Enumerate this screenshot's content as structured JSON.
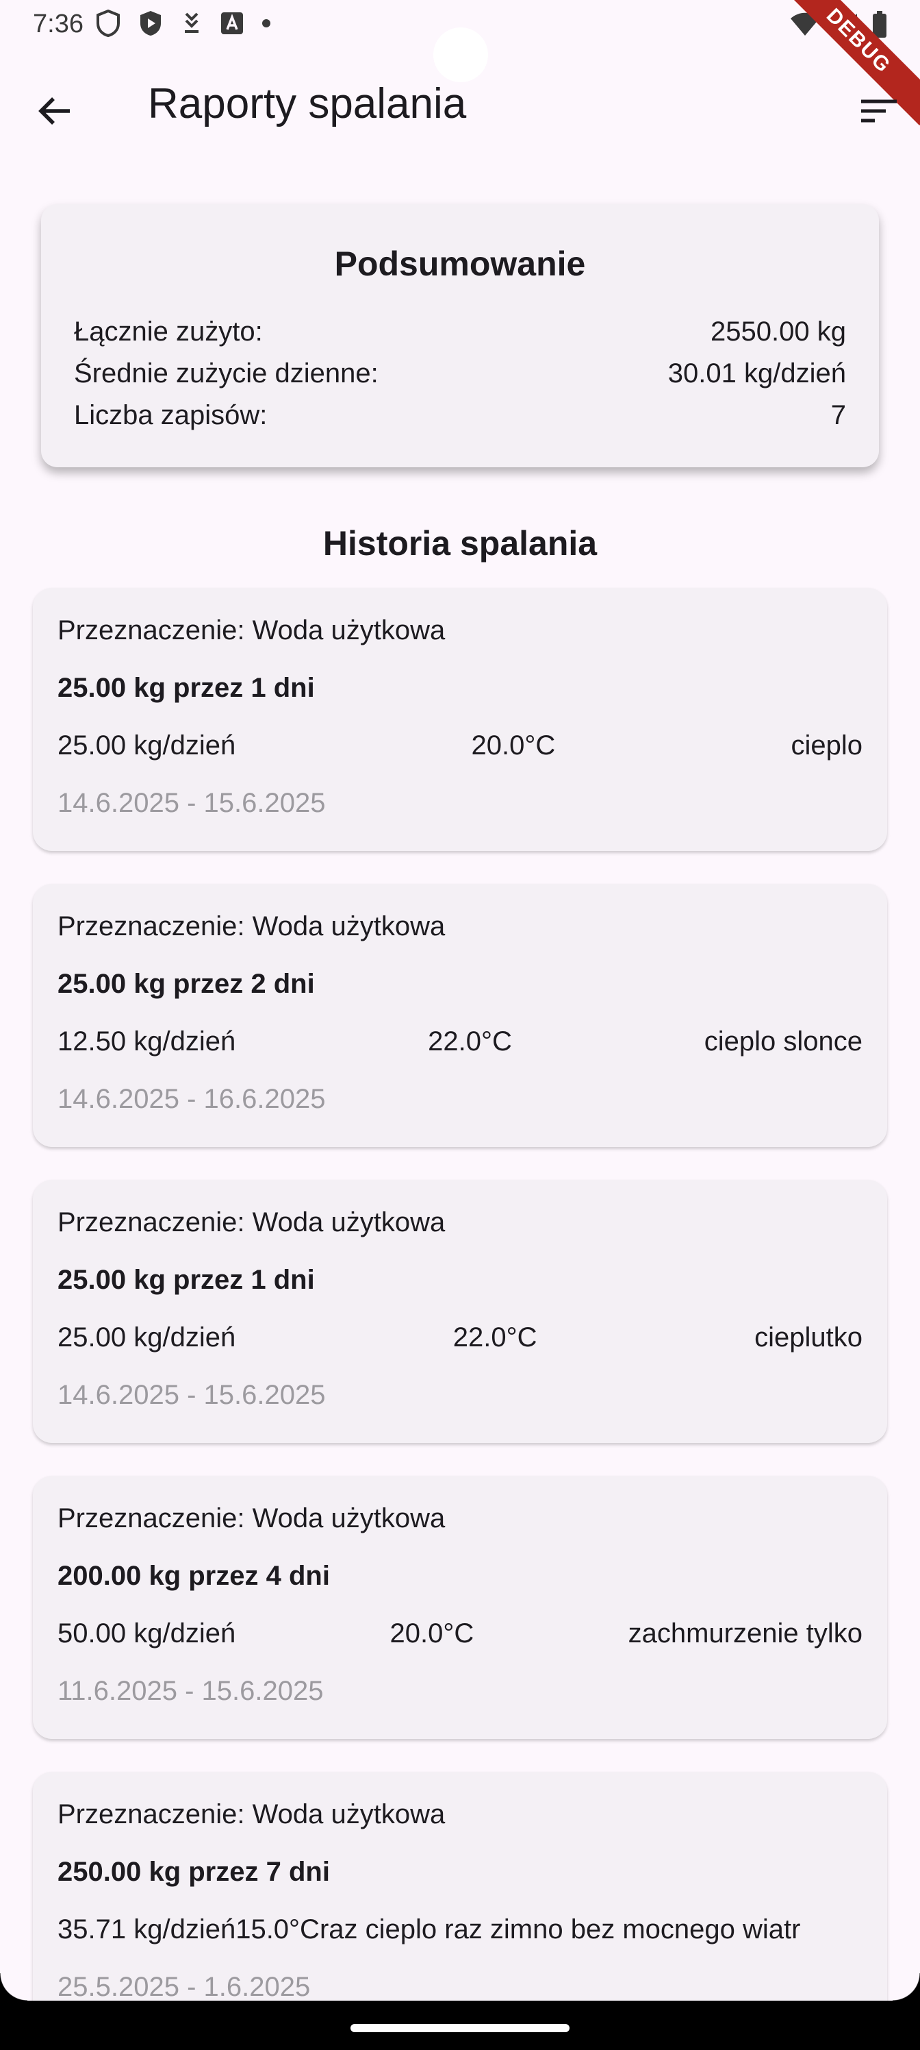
{
  "status_bar": {
    "time": "7:36",
    "debug_label": "DEBUG"
  },
  "app_bar": {
    "title": "Raporty spalania",
    "back_icon": "arrow-back-icon",
    "sort_icon": "sort-icon"
  },
  "summary": {
    "title": "Podsumowanie",
    "rows": [
      {
        "label": "Łącznie zużyto:",
        "value": "2550.00 kg"
      },
      {
        "label": "Średnie zużycie dzienne:",
        "value": "30.01 kg/dzień"
      },
      {
        "label": "Liczba zapisów:",
        "value": "7"
      }
    ]
  },
  "history": {
    "title": "Historia spalania",
    "entries": [
      {
        "purpose": "Przeznaczenie: Woda użytkowa",
        "amount": "25.00 kg przez 1 dni",
        "per_day": "25.00 kg/dzień",
        "temp": "20.0°C",
        "note": "cieplo",
        "dates": "14.6.2025 - 15.6.2025"
      },
      {
        "purpose": "Przeznaczenie: Woda użytkowa",
        "amount": "25.00 kg przez 2 dni",
        "per_day": "12.50 kg/dzień",
        "temp": "22.0°C",
        "note": "cieplo slonce",
        "dates": "14.6.2025 - 16.6.2025"
      },
      {
        "purpose": "Przeznaczenie: Woda użytkowa",
        "amount": "25.00 kg przez 1 dni",
        "per_day": "25.00 kg/dzień",
        "temp": "22.0°C",
        "note": "cieplutko",
        "dates": "14.6.2025 - 15.6.2025"
      },
      {
        "purpose": "Przeznaczenie: Woda użytkowa",
        "amount": "200.00 kg przez 4 dni",
        "per_day": "50.00 kg/dzień",
        "temp": "20.0°C",
        "note": "zachmurzenie tylko",
        "dates": "11.6.2025 - 15.6.2025"
      },
      {
        "purpose": "Przeznaczenie: Woda użytkowa",
        "amount": "250.00 kg przez 7 dni",
        "per_day": "35.71 kg/dzień",
        "temp": "15.0°C",
        "note": "raz cieplo raz zimno bez mocnego wiatr",
        "dates": "25.5.2025 - 1.6.2025"
      }
    ]
  }
}
